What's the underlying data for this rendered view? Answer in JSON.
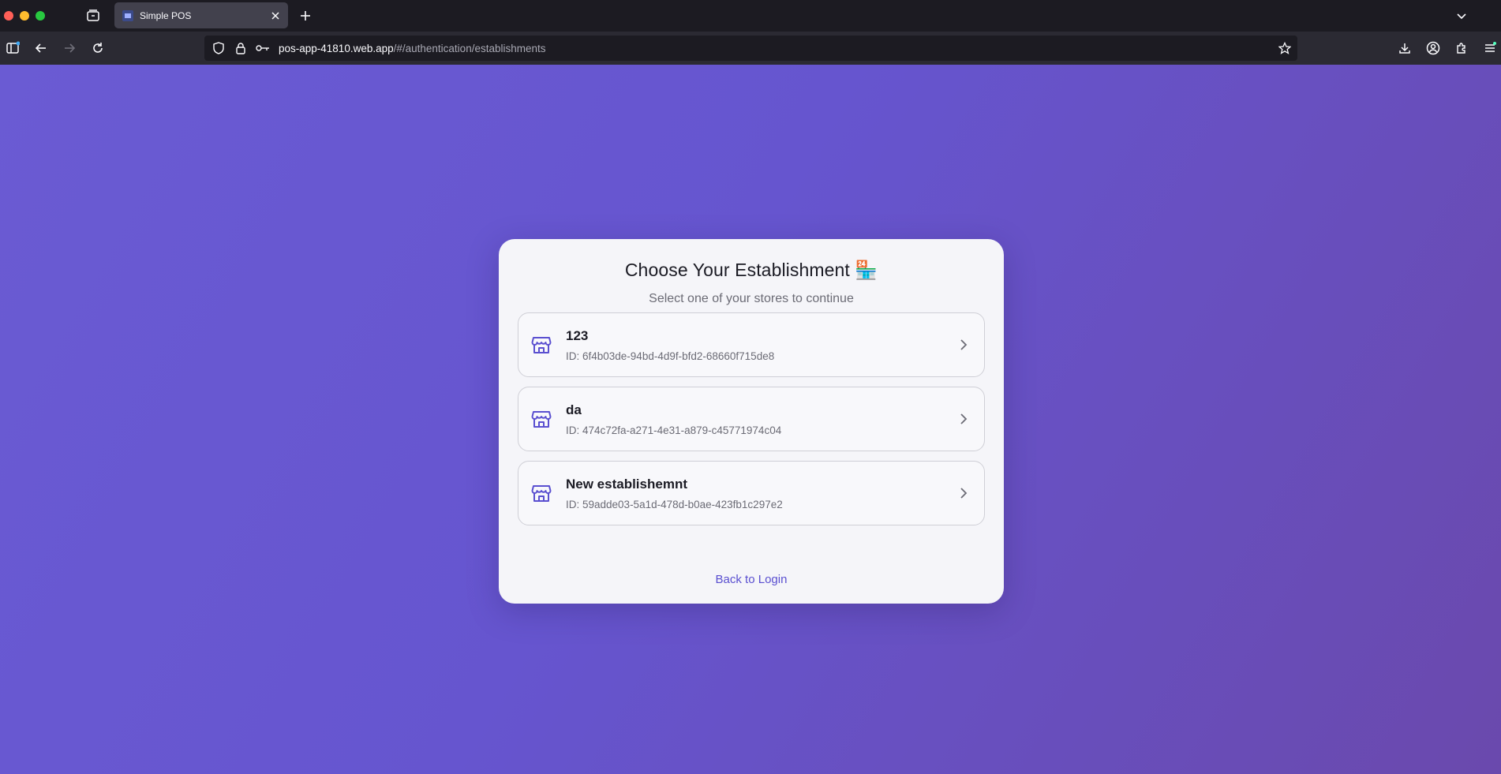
{
  "browser": {
    "tab": {
      "title": "Simple POS"
    },
    "url": {
      "host": "pos-app-41810.web.app",
      "path": "/#/authentication/establishments"
    }
  },
  "card": {
    "title": "Choose Your Establishment 🏪",
    "subtitle": "Select one of your stores to continue",
    "establishments": [
      {
        "name": "123",
        "id": "ID: 6f4b03de-94bd-4d9f-bfd2-68660f715de8"
      },
      {
        "name": "da",
        "id": "ID: 474c72fa-a271-4e31-a879-c45771974c04"
      },
      {
        "name": "New establishemnt",
        "id": "ID: 59adde03-5a1d-478d-b0ae-423fb1c297e2"
      }
    ],
    "back_link": "Back to Login"
  },
  "colors": {
    "accent": "#5a4fd0",
    "background_gradient_start": "#6a5bd3",
    "background_gradient_end": "#6a49ad",
    "card_background": "#f5f5f9"
  },
  "icons": {
    "establishment": "store-icon",
    "chevron": "chevron-right-icon"
  }
}
